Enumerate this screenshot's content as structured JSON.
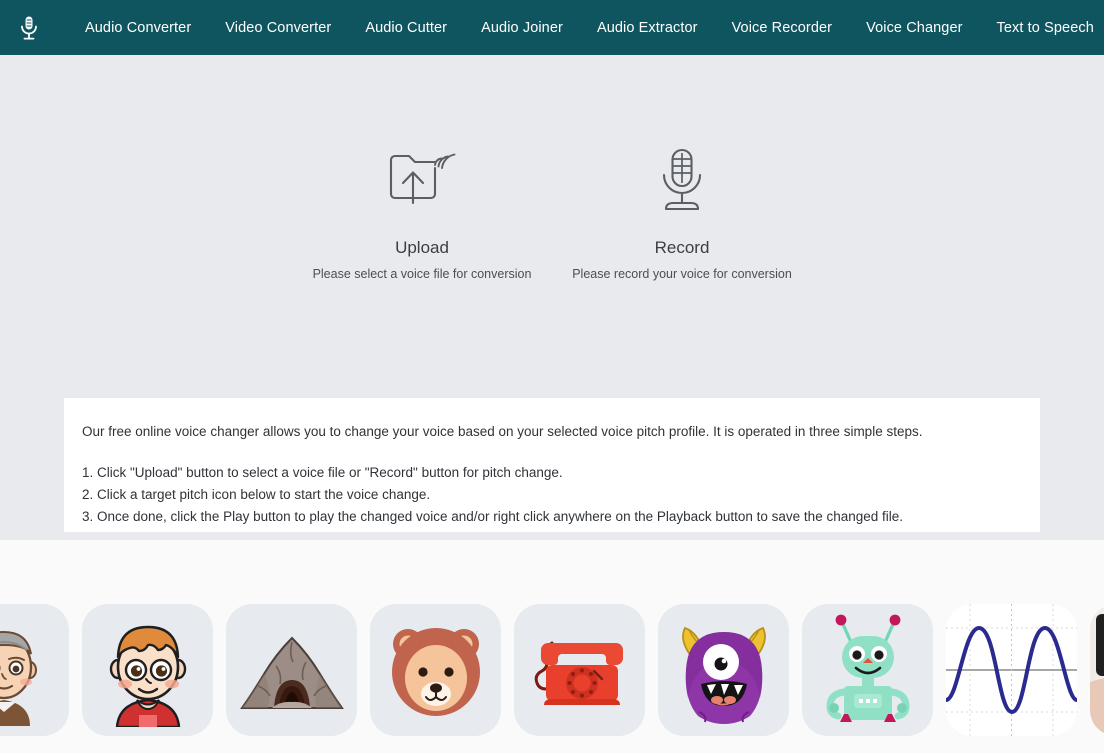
{
  "header": {
    "logo_icon": "microphone-icon",
    "brand_color": "#0f5560",
    "nav": [
      {
        "label": "Audio Converter"
      },
      {
        "label": "Video Converter"
      },
      {
        "label": "Audio Cutter"
      },
      {
        "label": "Audio Joiner"
      },
      {
        "label": "Audio Extractor"
      },
      {
        "label": "Voice Recorder"
      },
      {
        "label": "Voice Changer"
      },
      {
        "label": "Text to Speech"
      }
    ]
  },
  "actions": [
    {
      "icon": "folder-upload-sound-icon",
      "title": "Upload",
      "subtitle": "Please select a voice file for conversion"
    },
    {
      "icon": "microphone-record-icon",
      "title": "Record",
      "subtitle": "Please record your voice for conversion"
    }
  ],
  "instructions": {
    "lead": "Our free online voice changer allows you to change your voice based on your selected voice pitch profile. It is operated in three simple steps.",
    "steps": [
      "1. Click \"Upload\" button to select a voice file or \"Record\" button for pitch change.",
      "2. Click a target pitch icon below to start the voice change.",
      "3. Once done, click the Play button to play the changed voice and/or right click anywhere on the Playback button to save the changed file."
    ]
  },
  "pitch_tiles": [
    {
      "icon": "old-man-icon",
      "label": "Old Man"
    },
    {
      "icon": "boy-icon",
      "label": "Boy"
    },
    {
      "icon": "cave-icon",
      "label": "Cave"
    },
    {
      "icon": "bear-icon",
      "label": "Bear"
    },
    {
      "icon": "telephone-icon",
      "label": "Telephone"
    },
    {
      "icon": "monster-icon",
      "label": "Monster"
    },
    {
      "icon": "robot-icon",
      "label": "Robot"
    },
    {
      "icon": "sine-wave-icon",
      "label": "Sine Wave"
    },
    {
      "icon": "person-photo-icon",
      "label": "Person"
    }
  ],
  "colors": {
    "header_bg": "#0f5560",
    "page_bg": "#e8eaee",
    "card_bg": "#ffffff",
    "strip_bg": "#fafafa",
    "tile_bg": "#e7ebf0"
  }
}
